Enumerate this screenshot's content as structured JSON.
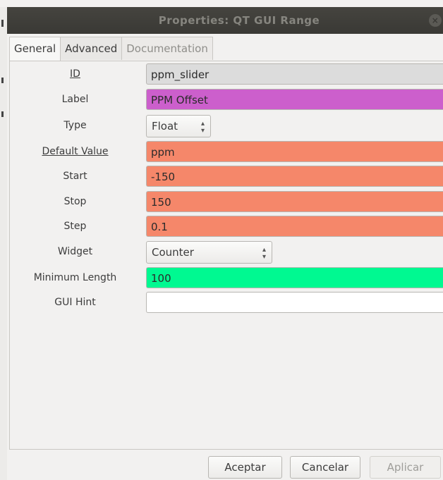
{
  "window": {
    "title": "Properties: QT GUI Range",
    "close_glyph": "×"
  },
  "tabs": [
    {
      "label": "General",
      "state": "active"
    },
    {
      "label": "Advanced",
      "state": "normal"
    },
    {
      "label": "Documentation",
      "state": "disabled"
    }
  ],
  "fields": {
    "id": {
      "label": "ID",
      "value": "ppm_slider",
      "color": "#dcdcdc"
    },
    "label": {
      "label": "Label",
      "value": "PPM Offset",
      "color": "#cc5fcc"
    },
    "type": {
      "label": "Type",
      "value": "Float"
    },
    "default_value": {
      "label": "Default Value",
      "value": "ppm",
      "color": "#f5876a"
    },
    "start": {
      "label": "Start",
      "value": "-150",
      "color": "#f5876a"
    },
    "stop": {
      "label": "Stop",
      "value": "150",
      "color": "#f5876a"
    },
    "step": {
      "label": "Step",
      "value": "0.1",
      "color": "#f5876a"
    },
    "widget": {
      "label": "Widget",
      "value": "Counter"
    },
    "minimum_length": {
      "label": "Minimum Length",
      "value": "100",
      "color": "#00f991"
    },
    "gui_hint": {
      "label": "GUI Hint",
      "value": "",
      "color": "#ffffff"
    }
  },
  "buttons": {
    "accept": "Aceptar",
    "cancel": "Cancelar",
    "apply": "Aplicar"
  },
  "icons": {
    "spin_arrows": "chevron-up-down-icon",
    "close": "close-icon"
  }
}
